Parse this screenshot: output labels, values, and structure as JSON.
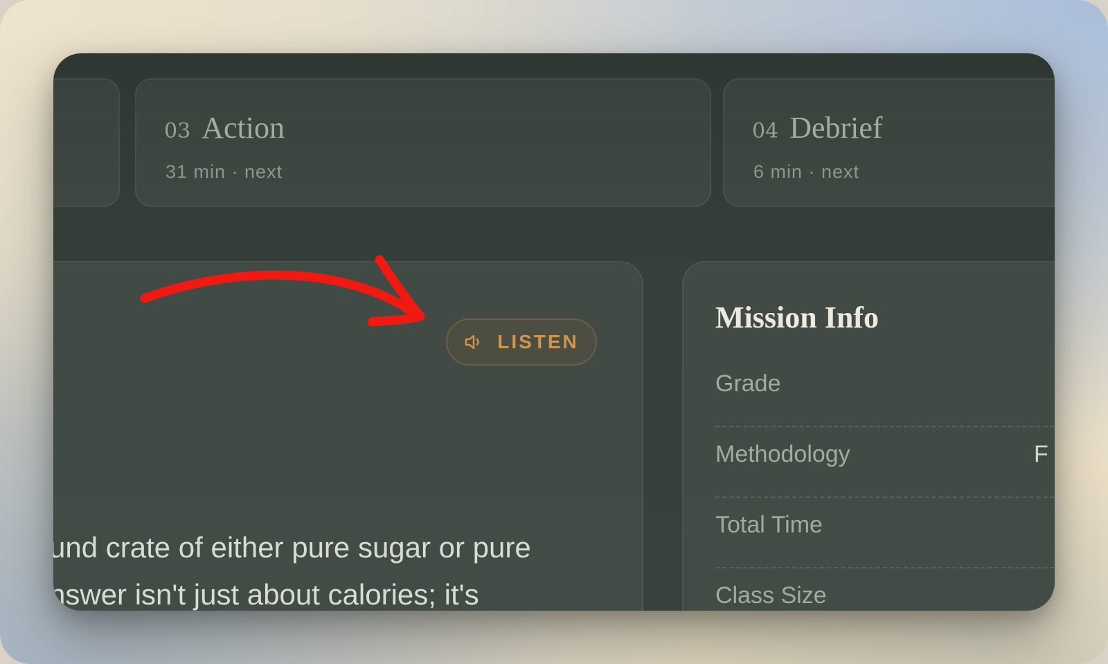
{
  "phases": [
    {
      "number": "03",
      "title": "Action",
      "meta": "31 min · next"
    },
    {
      "number": "04",
      "title": "Debrief",
      "meta": "6 min · next"
    }
  ],
  "listen_button": {
    "label": "LISTEN",
    "icon": "speaker-icon"
  },
  "lesson_text": {
    "line1": "und crate of either pure sugar or pure",
    "line2": "nswer isn't just about calories; it's"
  },
  "mission_info": {
    "title": "Mission Info",
    "rows": [
      {
        "label": "Grade",
        "value": ""
      },
      {
        "label": "Methodology",
        "value": "F"
      },
      {
        "label": "Total Time",
        "value": ""
      },
      {
        "label": "Class Size",
        "value": ""
      }
    ]
  },
  "annotation": {
    "color": "#f01a12"
  }
}
